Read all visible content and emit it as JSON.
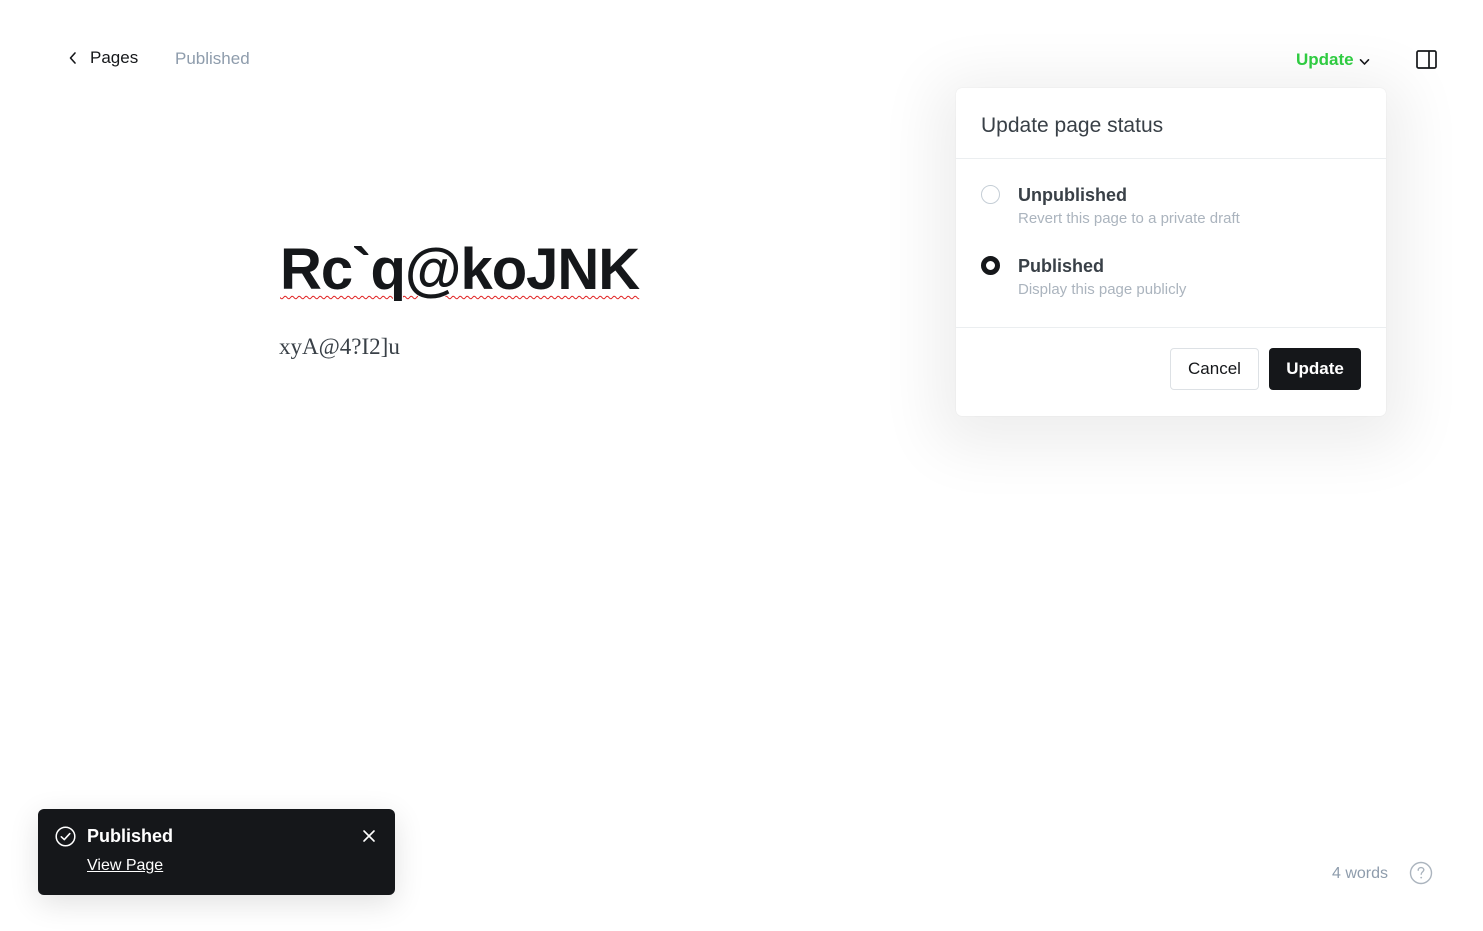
{
  "header": {
    "back_label": "Pages",
    "status": "Published",
    "update_label": "Update",
    "accent_color": "#30cf43"
  },
  "editor": {
    "title": "Rc`q@koJNK",
    "body": "xyA@4?I2]u"
  },
  "popover": {
    "title": "Update page status",
    "options": [
      {
        "label": "Unpublished",
        "description": "Revert this page to a private draft",
        "selected": false
      },
      {
        "label": "Published",
        "description": "Display this page publicly",
        "selected": true
      }
    ],
    "cancel_label": "Cancel",
    "confirm_label": "Update"
  },
  "toast": {
    "title": "Published",
    "link": "View Page",
    "icon": "check-circle-icon"
  },
  "footer": {
    "word_count": "4 words",
    "help_icon": "help-circle-icon"
  }
}
